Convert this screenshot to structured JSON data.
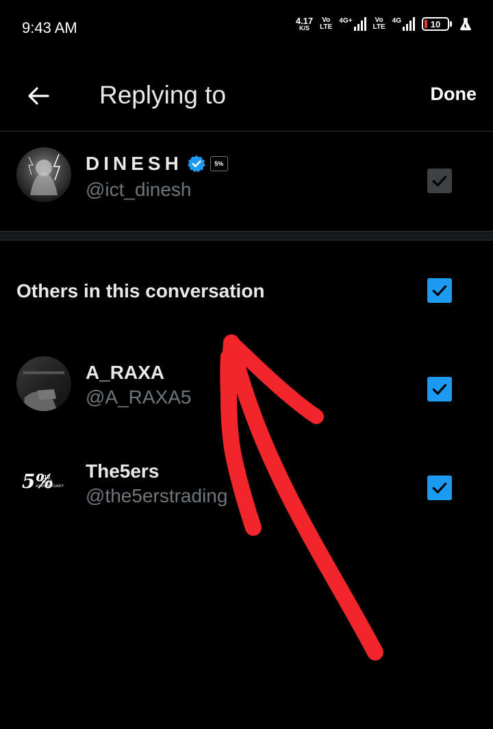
{
  "status_bar": {
    "time": "9:43 AM",
    "net_speed_value": "4.17",
    "net_speed_unit": "K/S",
    "sim1_top": "Vo",
    "sim1_bottom": "LTE",
    "sim1_network": "4G+",
    "sim2_top": "Vo",
    "sim2_bottom": "LTE",
    "sim2_network": "4G",
    "battery_level": "10"
  },
  "header": {
    "title": "Replying to",
    "done_label": "Done"
  },
  "primary_reply": {
    "name": "DINESH",
    "handle": "@ict_dinesh",
    "verified": true,
    "affiliate_badge_text": "5%",
    "checked": true
  },
  "others_section": {
    "label": "Others in this conversation",
    "checked": true,
    "users": [
      {
        "name": "A_RAXA",
        "handle": "@A_RAXA5",
        "checked": true
      },
      {
        "name": "The5ers",
        "handle": "@the5erstrading",
        "checked": true,
        "logo_main": "5%",
        "logo_sub1": "10",
        "logo_sub2": "YEAR",
        "logo_sub3": "ANNIVERSARY"
      }
    ]
  },
  "colors": {
    "background": "#000000",
    "accent_blue": "#1d9bf0",
    "muted_text": "#71767b",
    "annotation_red": "#f0262b"
  }
}
